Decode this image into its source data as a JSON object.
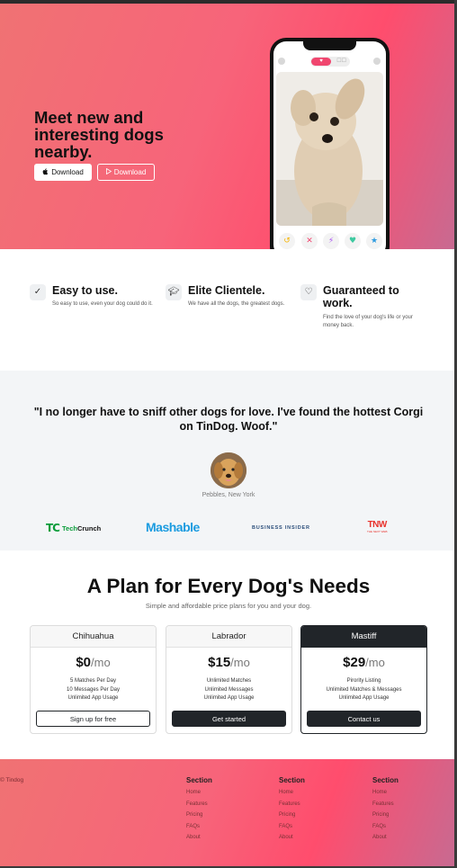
{
  "hero": {
    "title": "Meet new and interesting dogs nearby.",
    "download_apple": "Download",
    "download_play": "Download",
    "phone": {
      "toggle_on": "♥",
      "toggle_off": "☐☐"
    }
  },
  "features": [
    {
      "icon": "check-circle-icon",
      "title": "Easy to use.",
      "text": "So easy to use, even your dog could do it."
    },
    {
      "icon": "graduation-cap-icon",
      "title": "Elite Clientele.",
      "text": "We have all the dogs, the greatest dogs."
    },
    {
      "icon": "heart-arrow-icon",
      "title": "Guaranteed to work.",
      "text": "Find the love of your dog's life or your money back."
    }
  ],
  "testimonial": {
    "quote": "\"I no longer have to sniff other dogs for love. I've found the hottest Corgi on TinDog. Woof.\"",
    "name": "Pebbles, New York"
  },
  "press": {
    "techcrunch_mark": "TC",
    "techcrunch_a": "Tech",
    "techcrunch_b": "Crunch",
    "mashable": "Mashable",
    "business_insider": "BUSINESS INSIDER",
    "tnw": "TNW",
    "tnw_sub": "THE NEXT WEB"
  },
  "pricing": {
    "title": "A Plan for Every Dog's Needs",
    "subtitle": "Simple and affordable price plans for you and your dog.",
    "plans": [
      {
        "name": "Chihuahua",
        "price": "$0",
        "period": "/mo",
        "features": [
          "5 Matches Per Day",
          "10 Messages Per Day",
          "Unlimited App Usage"
        ],
        "button": "Sign up for free"
      },
      {
        "name": "Labrador",
        "price": "$15",
        "period": "/mo",
        "features": [
          "Unlimited Matches",
          "Unlimited Messages",
          "Unlimited App Usage"
        ],
        "button": "Get started"
      },
      {
        "name": "Mastiff",
        "price": "$29",
        "period": "/mo",
        "features": [
          "Pirority Listing",
          "Unlimited Matches & Messages",
          "Unlimited App Usage"
        ],
        "button": "Contact us"
      }
    ]
  },
  "footer": {
    "copyright": "© Tindog",
    "columns": [
      {
        "heading": "Section",
        "links": [
          "Home",
          "Features",
          "Pricing",
          "FAQs",
          "About"
        ]
      },
      {
        "heading": "Section",
        "links": [
          "Home",
          "Features",
          "Pricing",
          "FAQs",
          "About"
        ]
      },
      {
        "heading": "Section",
        "links": [
          "Home",
          "Features",
          "Pricing",
          "FAQs",
          "About"
        ]
      }
    ]
  },
  "colors": {
    "hero_gradient_start": "#f07273",
    "hero_gradient_mid": "#ff4d6d",
    "hero_gradient_end": "#c86a91",
    "dark": "#212529",
    "section_gray": "#f3f5f7"
  }
}
